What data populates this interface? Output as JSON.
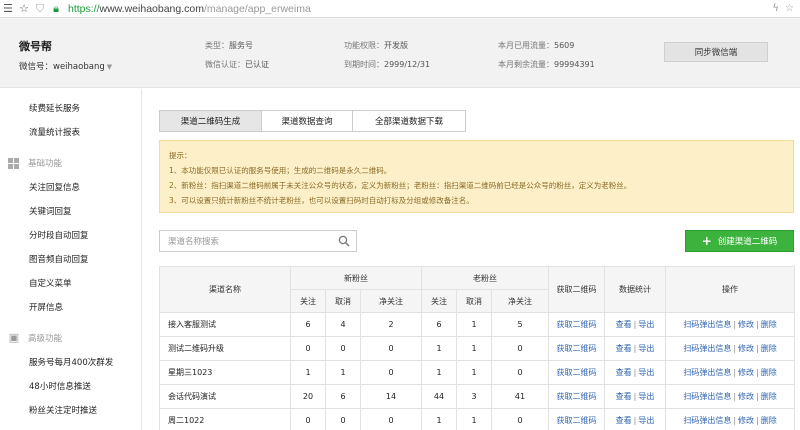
{
  "browser": {
    "url_scheme": "https://",
    "url_host": "www.weihaobang.com",
    "url_path": "/manage/app_erweima"
  },
  "header": {
    "brand": "微号帮",
    "account_label": "微信号：weihaobang",
    "info": [
      {
        "label": "类型：",
        "value": "服务号"
      },
      {
        "label": "微信认证：",
        "value": "已认证"
      },
      {
        "label": "功能权限：",
        "value": "开发版"
      },
      {
        "label": "到期时间：",
        "value": "2999/12/31"
      },
      {
        "label": "本月已用流量：",
        "value": "5609"
      },
      {
        "label": "本月剩余流量：",
        "value": "99994391"
      }
    ],
    "sync_button": "同步微信端"
  },
  "sidebar": {
    "top_items": [
      "续费延长服务",
      "流量统计报表"
    ],
    "groups": [
      {
        "title": "基础功能",
        "icon": "grid-icon",
        "items": [
          "关注回复信息",
          "关键词回复",
          "分时段自动回复",
          "图音频自动回复",
          "自定义菜单",
          "开屏信息"
        ]
      },
      {
        "title": "高级功能",
        "icon": "box-icon",
        "items": [
          "服务号每月400次群发",
          "48小时信息推送",
          "粉丝关注定时推送"
        ]
      }
    ]
  },
  "tabs": [
    "渠道二维码生成",
    "渠道数据查询",
    "全部渠道数据下载"
  ],
  "tip": {
    "title": "提示：",
    "lines": [
      "1、本功能仅限已认证的服务号使用；生成的二维码是永久二维码。",
      "2、新粉丝：指扫渠道二维码前属于未关注公众号的状态，定义为新粉丝；老粉丝：指扫渠道二维码前已经是公众号的粉丝，定义为老粉丝。",
      "3、可以设置只统计新粉丝不统计老粉丝，也可以设置扫码时自动打标及分组或修改备注名。"
    ]
  },
  "search": {
    "placeholder": "渠道名称搜索"
  },
  "create_button": "创建渠道二维码",
  "table": {
    "headers": {
      "name": "渠道名称",
      "new_fans": "新粉丝",
      "old_fans": "老粉丝",
      "get_qr": "获取二维码",
      "stats": "数据统计",
      "ops": "操作",
      "sub": [
        "关注",
        "取消",
        "净关注",
        "关注",
        "取消",
        "净关注"
      ]
    },
    "rows": [
      {
        "name": "接入客服测试",
        "nums": [
          "6",
          "4",
          "2",
          "6",
          "1",
          "5"
        ]
      },
      {
        "name": "测试二维码升级",
        "nums": [
          "0",
          "0",
          "0",
          "1",
          "1",
          "0"
        ]
      },
      {
        "name": "星期三1023",
        "nums": [
          "1",
          "1",
          "0",
          "1",
          "1",
          "0"
        ]
      },
      {
        "name": "会话代码演试",
        "nums": [
          "20",
          "6",
          "14",
          "44",
          "3",
          "41"
        ]
      },
      {
        "name": "周二1022",
        "nums": [
          "0",
          "0",
          "0",
          "1",
          "1",
          "0"
        ]
      }
    ],
    "get_qr_link": "获取二维码",
    "stats_links": [
      "查看",
      "导出"
    ],
    "op_links": [
      "扫码弹出信息",
      "修改",
      "删除"
    ]
  }
}
